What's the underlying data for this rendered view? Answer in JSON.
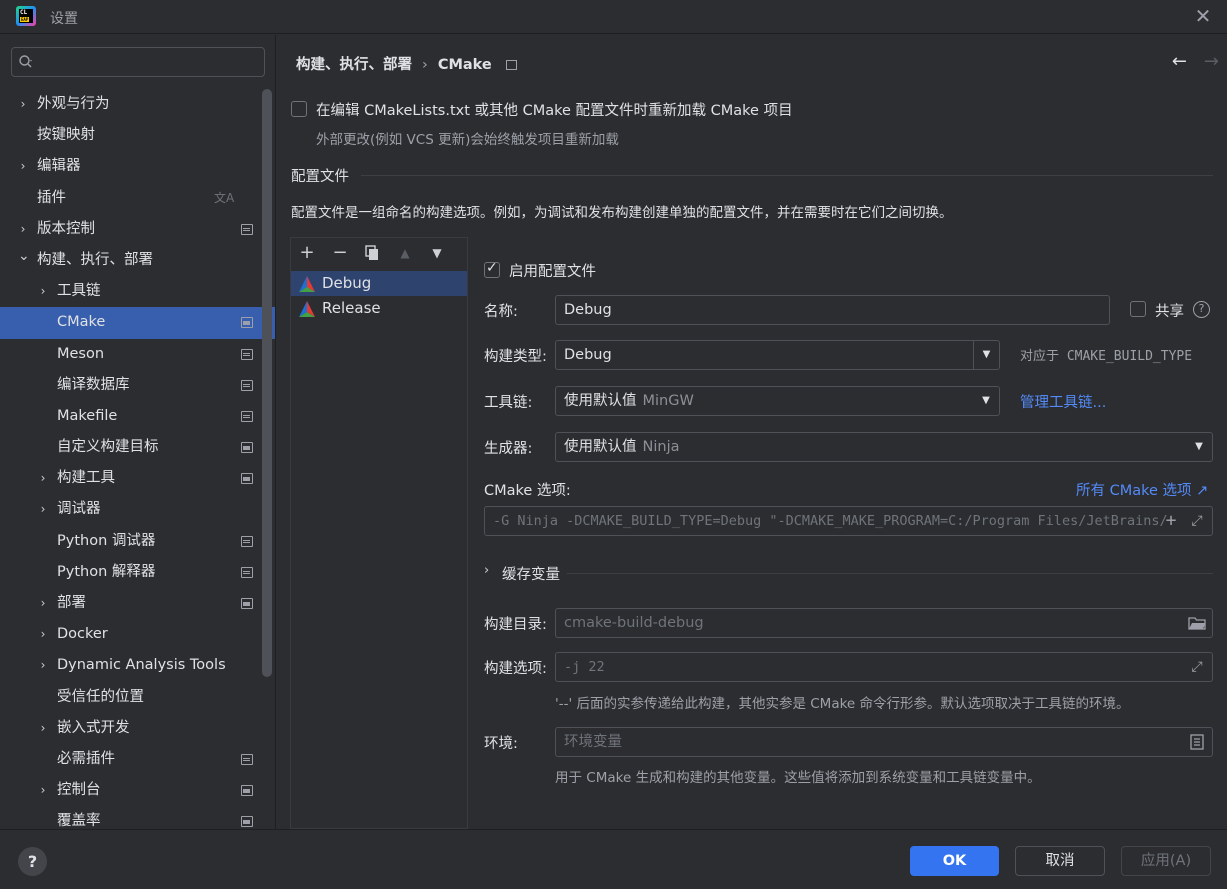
{
  "window": {
    "title": "设置",
    "logo_text": "CL",
    "logo_badge": "EAP"
  },
  "sidebar": {
    "search_placeholder": "",
    "items": [
      {
        "label": "外观与行为",
        "indent": 0,
        "chevron": "›"
      },
      {
        "label": "按键映射",
        "indent": 0
      },
      {
        "label": "编辑器",
        "indent": 0,
        "chevron": "›"
      },
      {
        "label": "插件",
        "indent": 0
      },
      {
        "label": "版本控制",
        "indent": 0,
        "chevron": "›"
      },
      {
        "label": "构建、执行、部署",
        "indent": 0,
        "chevron": "⌄"
      },
      {
        "label": "工具链",
        "indent": 1,
        "chevron": "›"
      },
      {
        "label": "CMake",
        "indent": 1
      },
      {
        "label": "Meson",
        "indent": 1
      },
      {
        "label": "编译数据库",
        "indent": 1
      },
      {
        "label": "Makefile",
        "indent": 1
      },
      {
        "label": "自定义构建目标",
        "indent": 1
      },
      {
        "label": "构建工具",
        "indent": 1,
        "chevron": "›"
      },
      {
        "label": "调试器",
        "indent": 1,
        "chevron": "›"
      },
      {
        "label": "Python 调试器",
        "indent": 1
      },
      {
        "label": "Python 解释器",
        "indent": 1
      },
      {
        "label": "部署",
        "indent": 1,
        "chevron": "›"
      },
      {
        "label": "Docker",
        "indent": 1,
        "chevron": "›"
      },
      {
        "label": "Dynamic Analysis Tools",
        "indent": 1,
        "chevron": "›"
      },
      {
        "label": "受信任的位置",
        "indent": 1
      },
      {
        "label": "嵌入式开发",
        "indent": 1,
        "chevron": "›"
      },
      {
        "label": "必需插件",
        "indent": 1
      },
      {
        "label": "控制台",
        "indent": 1,
        "chevron": "›"
      },
      {
        "label": "覆盖率",
        "indent": 1
      }
    ]
  },
  "header": {
    "breadcrumb_parent": "构建、执行、部署",
    "breadcrumb_sep": "›",
    "breadcrumb_current": "CMake"
  },
  "reload": {
    "label": "在编辑 CMakeLists.txt 或其他 CMake 配置文件时重新加载 CMake 项目",
    "hint": "外部更改(例如 VCS 更新)会始终触发项目重新加载"
  },
  "profiles_section": {
    "title": "配置文件",
    "description": "配置文件是一组命名的构建选项。例如，为调试和发布构建创建单独的配置文件，并在需要时在它们之间切换。",
    "profiles": [
      "Debug",
      "Release"
    ]
  },
  "details": {
    "enable_label": "启用配置文件",
    "name_label": "名称:",
    "name_value": "Debug",
    "share_label": "共享",
    "build_type_label": "构建类型:",
    "build_type_value": "Debug",
    "build_type_hint": "对应于 CMAKE_BUILD_TYPE",
    "toolchain_label": "工具链:",
    "toolchain_value": "使用默认值",
    "toolchain_sub": "MinGW",
    "toolchain_link": "管理工具链...",
    "generator_label": "生成器:",
    "generator_value": "使用默认值",
    "generator_sub": "Ninja",
    "cmake_options_label": "CMake 选项:",
    "cmake_options_link": "所有 CMake 选项 ↗",
    "cmake_options_value": "-G Ninja -DCMAKE_BUILD_TYPE=Debug \"-DCMAKE_MAKE_PROGRAM=C:/Program Files/JetBrains/",
    "cache_vars_label": "缓存变量",
    "build_dir_label": "构建目录:",
    "build_dir_placeholder": "cmake-build-debug",
    "build_options_label": "构建选项:",
    "build_options_placeholder": "-j 22",
    "build_options_hint": "'--' 后面的实参传递给此构建，其他实参是 CMake 命令行形参。默认选项取决于工具链的环境。",
    "env_label": "环境:",
    "env_placeholder": "环境变量",
    "env_hint": "用于 CMake 生成和构建的其他变量。这些值将添加到系统变量和工具链变量中。"
  },
  "footer": {
    "help": "?",
    "ok": "OK",
    "cancel": "取消",
    "apply": "应用(A)"
  }
}
